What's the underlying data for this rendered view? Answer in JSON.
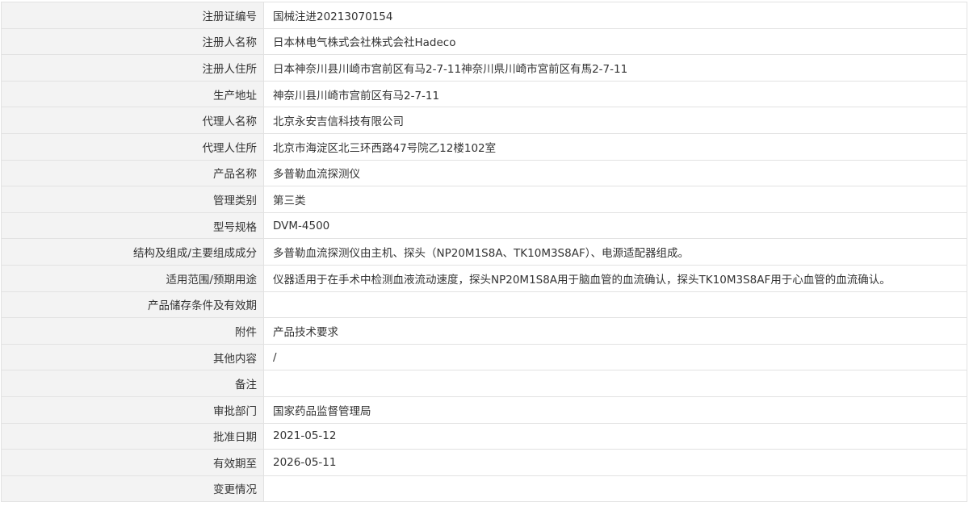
{
  "record": {
    "rows": [
      {
        "label": "注册证编号",
        "value": "国械注进20213070154"
      },
      {
        "label": "注册人名称",
        "value": "日本林电气株式会社株式会社Hadeco"
      },
      {
        "label": "注册人住所",
        "value": "日本神奈川县川崎市宫前区有马2-7-11神奈川県川崎市宮前区有馬2-7-11"
      },
      {
        "label": "生产地址",
        "value": "神奈川县川崎市宫前区有马2-7-11"
      },
      {
        "label": "代理人名称",
        "value": "北京永安吉信科技有限公司"
      },
      {
        "label": "代理人住所",
        "value": "北京市海淀区北三环西路47号院乙12楼102室"
      },
      {
        "label": "产品名称",
        "value": "多普勒血流探测仪"
      },
      {
        "label": "管理类别",
        "value": "第三类"
      },
      {
        "label": "型号规格",
        "value": "DVM-4500"
      },
      {
        "label": "结构及组成/主要组成成分",
        "value": "多普勒血流探测仪由主机、探头（NP20M1S8A、TK10M3S8AF）、电源适配器组成。"
      },
      {
        "label": "适用范围/预期用途",
        "value": "仪器适用于在手术中检测血液流动速度，探头NP20M1S8A用于脑血管的血流确认，探头TK10M3S8AF用于心血管的血流确认。"
      },
      {
        "label": "产品储存条件及有效期",
        "value": ""
      },
      {
        "label": "附件",
        "value": "产品技术要求"
      },
      {
        "label": "其他内容",
        "value": "/"
      },
      {
        "label": "备注",
        "value": ""
      },
      {
        "label": "审批部门",
        "value": "国家药品监督管理局"
      },
      {
        "label": "批准日期",
        "value": "2021-05-12"
      },
      {
        "label": "有效期至",
        "value": "2026-05-11"
      },
      {
        "label": "变更情况",
        "value": ""
      }
    ]
  },
  "colors": {
    "label_background": "#f3f3f3",
    "border": "#e2e2e2",
    "text": "#333333"
  }
}
